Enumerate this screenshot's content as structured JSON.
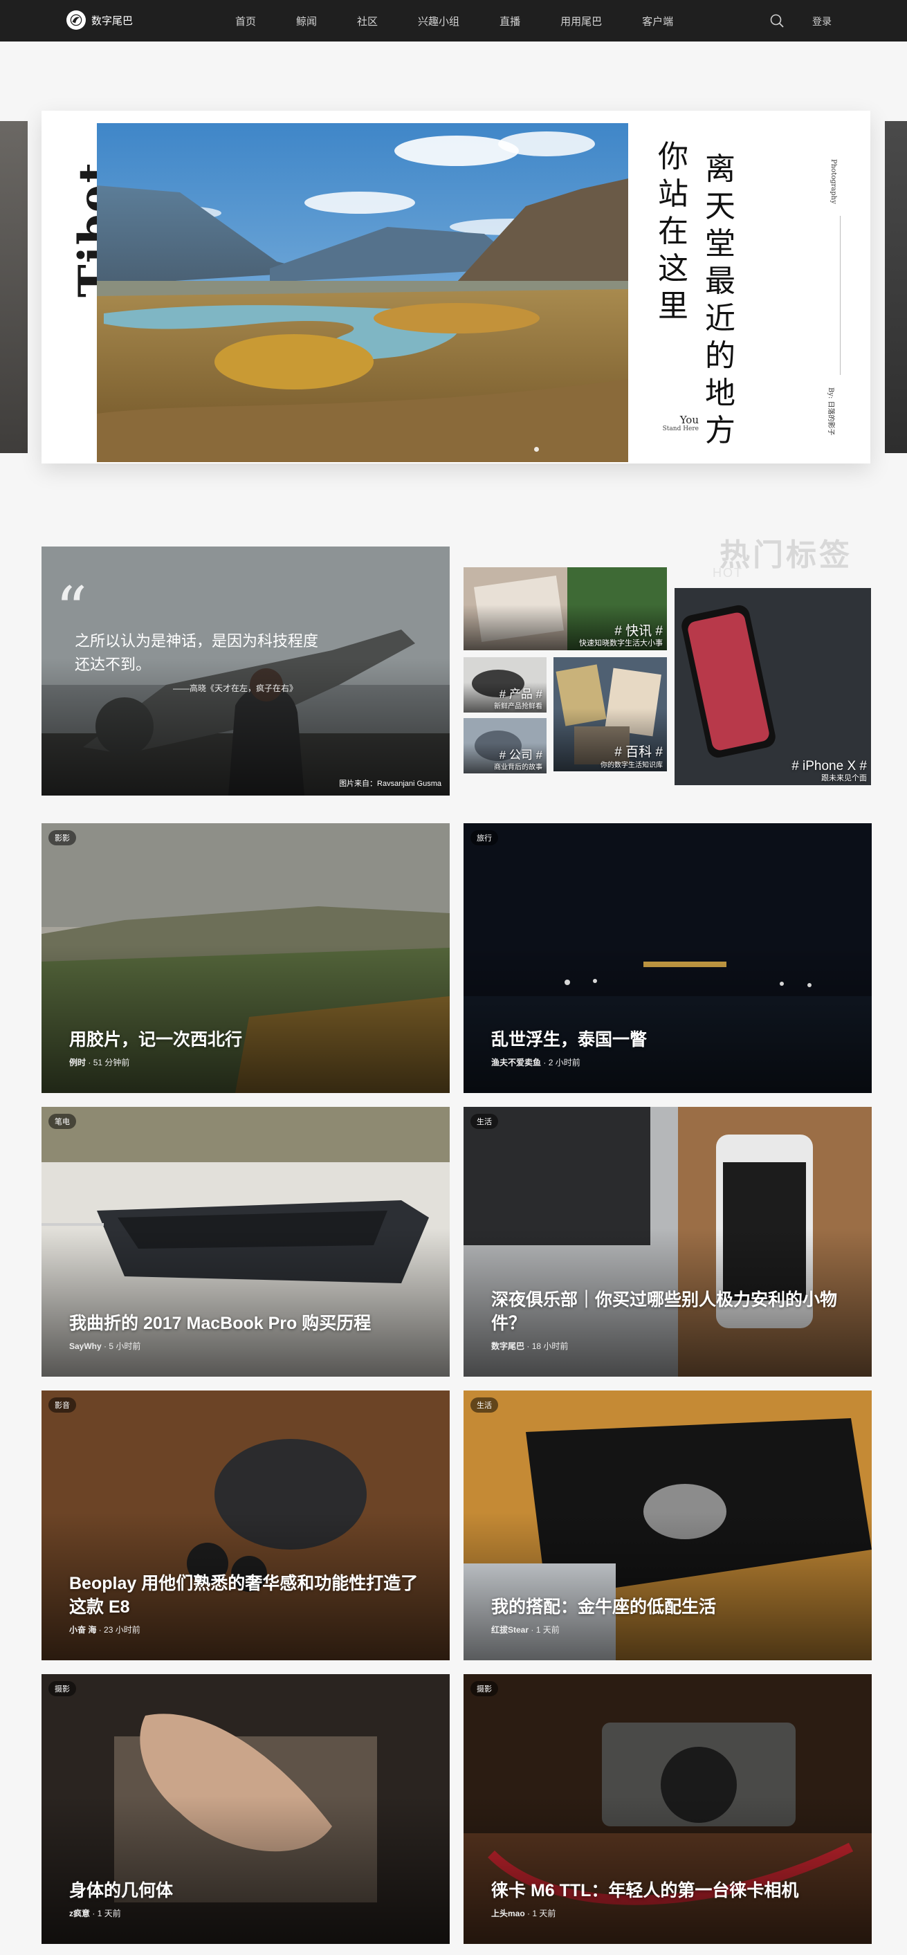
{
  "nav": {
    "logo_text": "数字尾巴",
    "items": [
      "首页",
      "鲸闻",
      "社区",
      "兴趣小组",
      "直播",
      "用用尾巴",
      "客户端"
    ],
    "login": "登录"
  },
  "hero": {
    "vertical_word": "Tibet",
    "line1": "你站在这里",
    "line2": "离天堂最近的地方",
    "you": "You",
    "stand_here": "Stand Here",
    "photography": "Photography",
    "by": "By: 日落的影子"
  },
  "hot": {
    "title": "热门标签",
    "subtitle": "HOT"
  },
  "quote_card": {
    "text": "之所以认为是神话，是因为科技程度还达不到。",
    "source": "——高晓《天才在左，疯子在右》",
    "credit": "图片来自：Ravsanjani Gusma"
  },
  "tags": [
    {
      "tag": "# 快讯 #",
      "desc": "快速知晓数字生活大小事"
    },
    {
      "tag": "# 产品 #",
      "desc": "新鲜产品抢鲜看"
    },
    {
      "tag": "# 公司 #",
      "desc": "商业背后的故事"
    },
    {
      "tag": "# 百科 #",
      "desc": "你的数字生活知识库"
    },
    {
      "tag": "# iPhone X #",
      "desc": "跟未来见个面"
    }
  ],
  "articles": [
    {
      "category": "影影",
      "title": "用胶片，记一次西北行",
      "author": "例时",
      "time": "51 分钟前"
    },
    {
      "category": "旅行",
      "title": "乱世浮生，泰国一瞥",
      "author": "渔夫不爱卖鱼",
      "time": "2 小时前"
    },
    {
      "category": "笔电",
      "title": "我曲折的 2017 MacBook Pro 购买历程",
      "author": "SayWhy",
      "time": "5 小时前"
    },
    {
      "category": "生活",
      "title": "深夜俱乐部｜你买过哪些别人极力安利的小物件？",
      "author": "数字尾巴",
      "time": "18 小时前"
    },
    {
      "category": "影音",
      "title": "Beoplay 用他们熟悉的奢华感和功能性打造了这款 E8",
      "author": "小奋 海",
      "time": "23 小时前"
    },
    {
      "category": "生活",
      "title": "我的搭配：金牛座的低配生活",
      "author": "红拔Stear",
      "time": "1 天前"
    },
    {
      "category": "摄影",
      "title": "身体的几何体",
      "author": "z疯意",
      "time": "1 天前"
    },
    {
      "category": "摄影",
      "title": "徕卡 M6 TTL：年轻人的第一台徕卡相机",
      "author": "上头mao",
      "time": "1 天前"
    }
  ]
}
